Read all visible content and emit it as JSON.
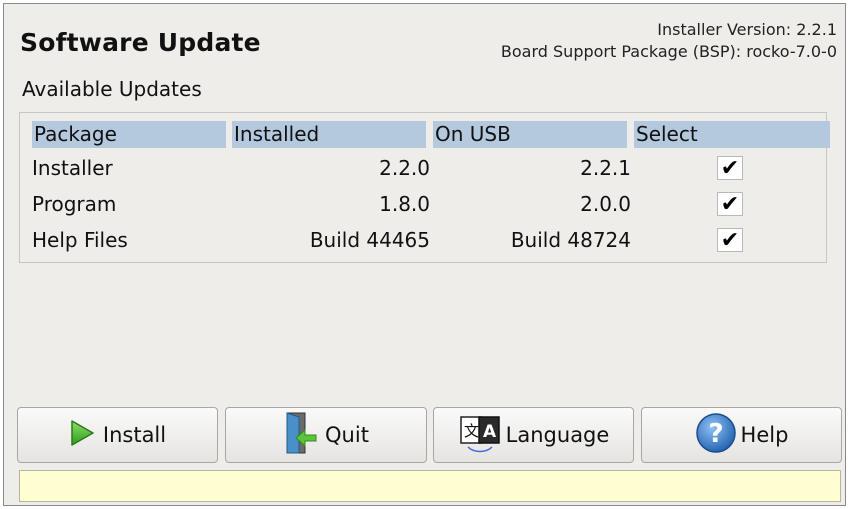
{
  "window": {
    "title": "Software Update",
    "installer_version_label": "Installer Version",
    "installer_version_value": "2.2.1",
    "bsp_label": "Board Support Package (BSP)",
    "bsp_value": "rocko-7.0-0"
  },
  "updates": {
    "section_label": "Available Updates",
    "columns": [
      "Package",
      "Installed",
      "On USB",
      "Select"
    ],
    "rows": [
      {
        "package": "Installer",
        "installed": "2.2.0",
        "on_usb": "2.2.1",
        "selected": "✔"
      },
      {
        "package": "Program",
        "installed": "1.8.0",
        "on_usb": "2.0.0",
        "selected": "✔"
      },
      {
        "package": "Help Files",
        "installed": "Build 44465",
        "on_usb": "Build 48724",
        "selected": "✔"
      }
    ]
  },
  "buttons": {
    "install": {
      "label": "Install",
      "icon": "play-icon"
    },
    "quit": {
      "label": "Quit",
      "icon": "exit-door-icon"
    },
    "language": {
      "label": "Language",
      "icon": "language-icon"
    },
    "help": {
      "label": "Help",
      "icon": "help-icon"
    }
  },
  "status_bar": {
    "text": ""
  },
  "colors": {
    "header_bg": "#b4c8de",
    "status_bg": "#ffffd2",
    "window_bg": "#efedea"
  }
}
